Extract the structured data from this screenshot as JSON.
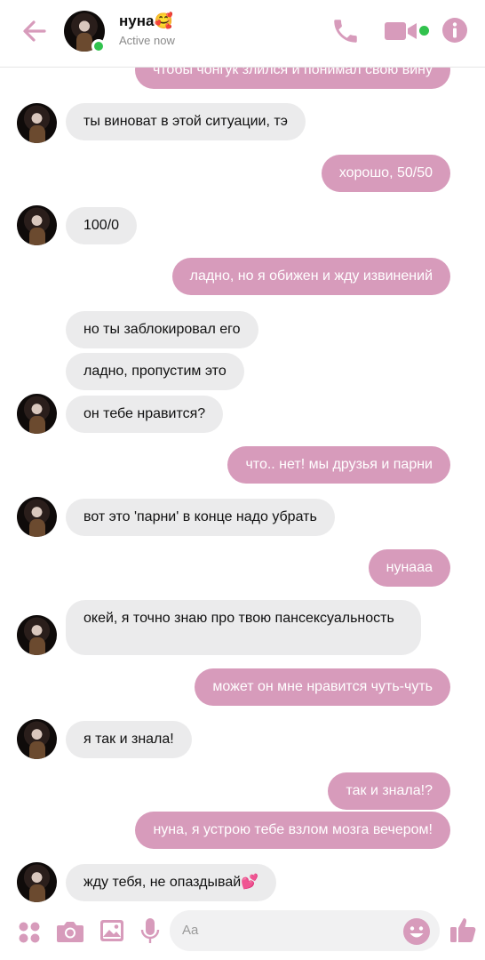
{
  "header": {
    "contact_name": "нуна🥰",
    "status": "Active now"
  },
  "messages": [
    {
      "dir": "out",
      "text": "чтобы чонгук злился и понимал свою вину",
      "avatar": false
    },
    {
      "dir": "in",
      "text": "ты виноват в этой ситуации, тэ",
      "avatar": true
    },
    {
      "dir": "out",
      "text": "хорошо, 50/50",
      "avatar": false
    },
    {
      "dir": "in",
      "text": "100/0",
      "avatar": true
    },
    {
      "dir": "out",
      "text": "ладно, но я обижен и жду извинений",
      "avatar": false
    },
    {
      "dir": "in",
      "text": "но ты заблокировал его",
      "avatar": false
    },
    {
      "dir": "in",
      "text": "ладно, пропустим это",
      "avatar": false
    },
    {
      "dir": "in",
      "text": "он тебе нравится?",
      "avatar": true
    },
    {
      "dir": "out",
      "text": "что.. нет! мы друзья и парни",
      "avatar": false
    },
    {
      "dir": "in",
      "text": "вот это 'парни' в конце надо убрать",
      "avatar": true
    },
    {
      "dir": "out",
      "text": "нунааа",
      "avatar": false
    },
    {
      "dir": "in",
      "text": "окей, я точно знаю про твою пансексуальность",
      "avatar": true
    },
    {
      "dir": "out",
      "text": "может он мне нравится чуть-чуть",
      "avatar": false
    },
    {
      "dir": "in",
      "text": "я так и знала!",
      "avatar": true
    },
    {
      "dir": "out",
      "text": "так и знала!?",
      "avatar": false
    },
    {
      "dir": "out",
      "text": "нуна, я устрою тебе взлом мозга вечером!",
      "avatar": false
    },
    {
      "dir": "in",
      "text": "жду тебя, не опаздывай💕",
      "avatar": true
    }
  ],
  "composer": {
    "placeholder": "Aa"
  },
  "colors": {
    "accent": "#d79bbb",
    "incoming_bubble": "#ebebec",
    "online": "#31c24d"
  }
}
